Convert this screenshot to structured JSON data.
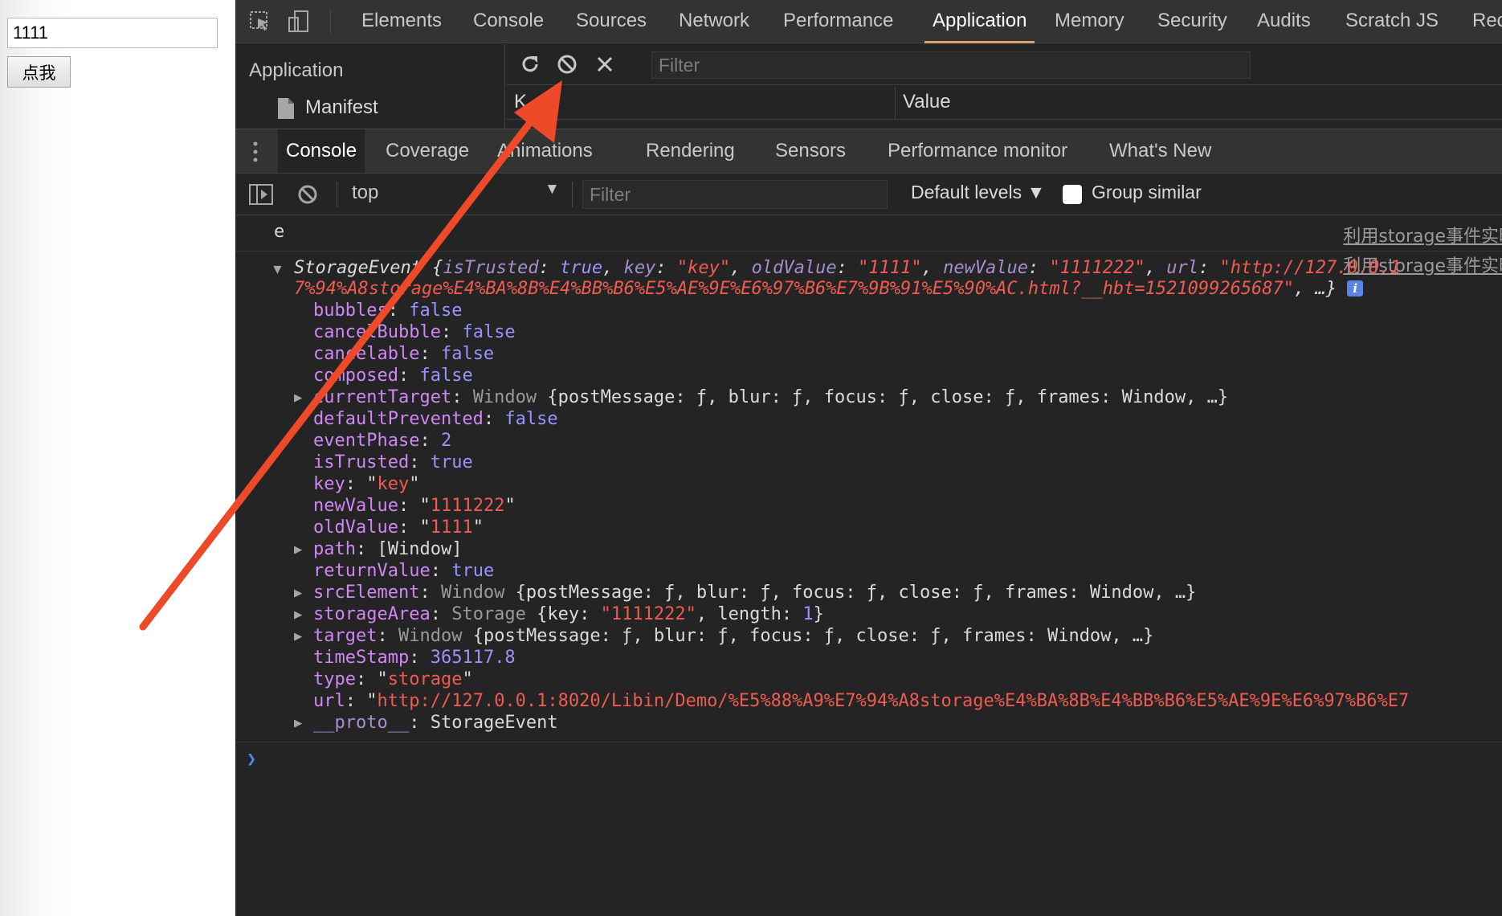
{
  "page": {
    "input_value": "1111",
    "button_label": "点我"
  },
  "devtools": {
    "main_tabs": [
      "Elements",
      "Console",
      "Sources",
      "Network",
      "Performance",
      "Application",
      "Memory",
      "Security",
      "Audits",
      "Scratch JS",
      "Rec"
    ],
    "active_main_tab": "Application",
    "icons": [
      "inspect-element-icon",
      "device-toolbar-icon"
    ],
    "application": {
      "sidebar_title": "Application",
      "sidebar_items": [
        "Manifest"
      ],
      "filter_placeholder": "Filter",
      "toolbar_icons": [
        "refresh-icon",
        "clear-icon",
        "delete-icon"
      ],
      "table_key_header": "K",
      "table_value_header": "Value"
    },
    "drawer": {
      "tabs": [
        "Console",
        "Coverage",
        "Animations",
        "Rendering",
        "Sensors",
        "Performance monitor",
        "What's New"
      ],
      "active_tab": "Console"
    },
    "console_toolbar": {
      "context": "top",
      "filter_placeholder": "Filter",
      "levels": "Default levels ▼",
      "group_similar": "Group similar",
      "group_similar_checked": false
    },
    "console": {
      "log_e": "e",
      "source_link": "利用storage事件实时监",
      "source_link_2": "利用storage事件实时监",
      "summary": {
        "prefix": "StorageEvent {",
        "isTrusted_key": "isTrusted",
        "isTrusted_val": "true",
        "key_key": "key",
        "key_val": "\"key\"",
        "oldValue_key": "oldValue",
        "oldValue_val": "\"1111\"",
        "newValue_key": "newValue",
        "newValue_val": "\"1111222\"",
        "url_key": "url",
        "url_val": "\"http://127.0.0.1",
        "line2": "7%94%A8storage%E4%BA%8B%E4%BB%B6%E5%AE%9E%E6%97%B6%E7%9B%91%E5%90%AC.html?__hbt=1521099265687\"",
        "line2_suffix": ", …}",
        "info_badge": "i"
      },
      "props": {
        "bubbles": "false",
        "cancelBubble": "false",
        "cancelable": "false",
        "composed": "false",
        "currentTarget_class": "Window",
        "currentTarget_val": "{postMessage: ƒ, blur: ƒ, focus: ƒ, close: ƒ, frames: Window, …}",
        "defaultPrevented": "false",
        "eventPhase": "2",
        "isTrusted": "true",
        "key": "key",
        "newValue": "1111222",
        "oldValue": "1111",
        "path": "[Window]",
        "returnValue": "true",
        "srcElement_class": "Window",
        "srcElement_val": "{postMessage: ƒ, blur: ƒ, focus: ƒ, close: ƒ, frames: Window, …}",
        "storageArea_class": "Storage",
        "storageArea_key": "\"1111222\"",
        "storageArea_length": "1",
        "target_class": "Window",
        "target_val": "{postMessage: ƒ, blur: ƒ, focus: ƒ, close: ƒ, frames: Window, …}",
        "timeStamp": "365117.8",
        "type": "storage",
        "url": "http://127.0.0.1:8020/Libin/Demo/%E5%88%A9%E7%94%A8storage%E4%BA%8B%E4%BB%B6%E5%AE%9E%E6%97%B6%E7",
        "proto": "StorageEvent"
      },
      "labels": {
        "bubbles": "bubbles",
        "cancelBubble": "cancelBubble",
        "cancelable": "cancelable",
        "composed": "composed",
        "currentTarget": "currentTarget",
        "defaultPrevented": "defaultPrevented",
        "eventPhase": "eventPhase",
        "isTrusted": "isTrusted",
        "key": "key",
        "newValue": "newValue",
        "oldValue": "oldValue",
        "path": "path",
        "returnValue": "returnValue",
        "srcElement": "srcElement",
        "storageArea": "storageArea",
        "target": "target",
        "timeStamp": "timeStamp",
        "type": "type",
        "url": "url",
        "proto": "__proto__"
      }
    }
  },
  "annotation": {
    "color": "#ee4a2a"
  }
}
